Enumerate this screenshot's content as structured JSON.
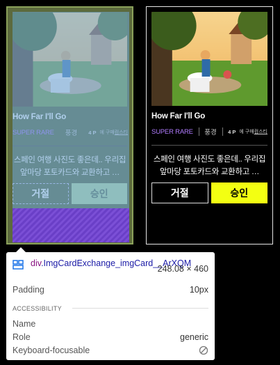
{
  "cards": [
    {
      "title": "How Far I'll Go",
      "rarity": "SUPER RARE",
      "category": "풍경",
      "points": "4 P",
      "shop_prefix": "에 구매",
      "shop_link": "컴스티",
      "description": "스페인 여행 사진도 좋은데.. 우리집 앞마당 포토카드와 교환하고 …",
      "reject_label": "거절",
      "approve_label": "승인"
    },
    {
      "title": "How Far I'll Go",
      "rarity": "SUPER RARE",
      "category": "풍경",
      "points": "4 P",
      "shop_prefix": "에 구매",
      "shop_link": "컴스티",
      "description": "스페인 여행 사진도 좋은데.. 우리집 앞마당 포토카드와 교환하고 …",
      "reject_label": "거절",
      "approve_label": "승인"
    }
  ],
  "inspector": {
    "element_tag": "div",
    "element_class": ".ImgCardExchange_imgCard__ArXQM",
    "size": "248.08 × 460",
    "padding_label": "Padding",
    "padding_value": "10px",
    "accessibility_header": "ACCESSIBILITY",
    "name_label": "Name",
    "role_label": "Role",
    "role_value": "generic",
    "focusable_label": "Keyboard-focusable"
  },
  "colors": {
    "accent": "#f3ff12",
    "rarity": "#b17cff",
    "highlight_content": "#6fa8dc",
    "highlight_padding": "#6a3fc7"
  }
}
